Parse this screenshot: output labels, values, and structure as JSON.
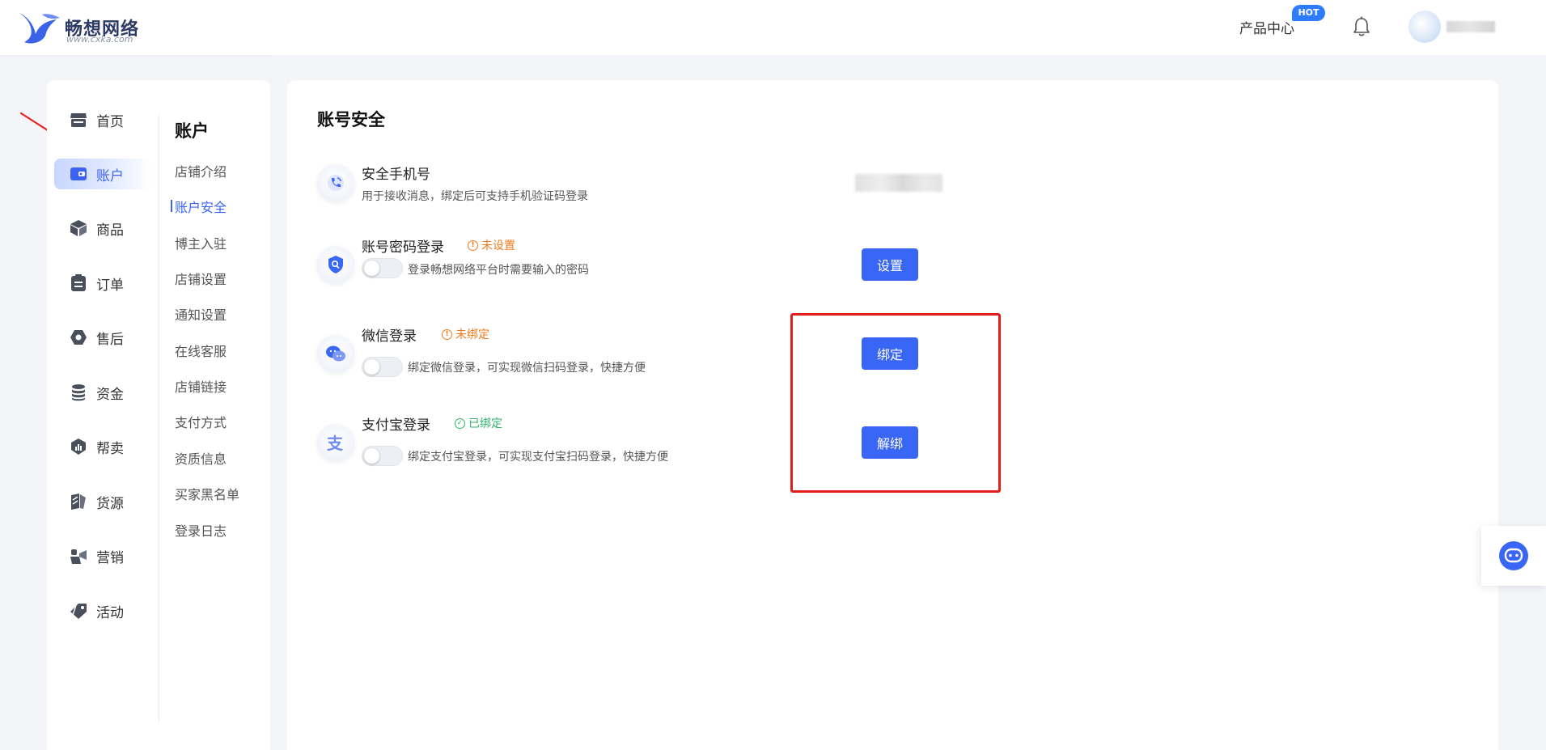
{
  "header": {
    "brand_name": "畅想网络",
    "brand_url": "www.cxka.com",
    "product_center": "产品中心",
    "hot_badge": "HOT"
  },
  "nav": {
    "items": [
      {
        "label": "首页",
        "icon": "store-icon"
      },
      {
        "label": "账户",
        "icon": "wallet-icon",
        "active": true
      },
      {
        "label": "商品",
        "icon": "box-icon"
      },
      {
        "label": "订单",
        "icon": "order-icon"
      },
      {
        "label": "售后",
        "icon": "aftersale-icon"
      },
      {
        "label": "资金",
        "icon": "coins-icon"
      },
      {
        "label": "帮卖",
        "icon": "chart-shield-icon"
      },
      {
        "label": "货源",
        "icon": "supply-icon"
      },
      {
        "label": "营销",
        "icon": "marketing-icon"
      },
      {
        "label": "活动",
        "icon": "tag-icon"
      }
    ]
  },
  "subnav": {
    "title": "账户",
    "items": [
      "店铺介绍",
      "账户安全",
      "博主入驻",
      "店铺设置",
      "通知设置",
      "在线客服",
      "店铺链接",
      "支付方式",
      "资质信息",
      "买家黑名单",
      "登录日志"
    ],
    "active_index": 1
  },
  "main": {
    "title": "账号安全",
    "phone": {
      "title": "安全手机号",
      "desc": "用于接收消息，绑定后可支持手机验证码登录"
    },
    "password": {
      "title": "账号密码登录",
      "status": "未设置",
      "desc": "登录畅想网络平台时需要输入的密码",
      "button": "设置"
    },
    "wechat": {
      "title": "微信登录",
      "status": "未绑定",
      "desc": "绑定微信登录，可实现微信扫码登录，快捷方便",
      "button": "绑定"
    },
    "alipay": {
      "title": "支付宝登录",
      "status": "已绑定",
      "desc": "绑定支付宝登录，可实现支付宝扫码登录，快捷方便",
      "button": "解绑"
    }
  },
  "colors": {
    "accent": "#3a66f5",
    "warning": "#f07a1e",
    "success": "#2fb36a",
    "highlight": "#e21b1b"
  }
}
